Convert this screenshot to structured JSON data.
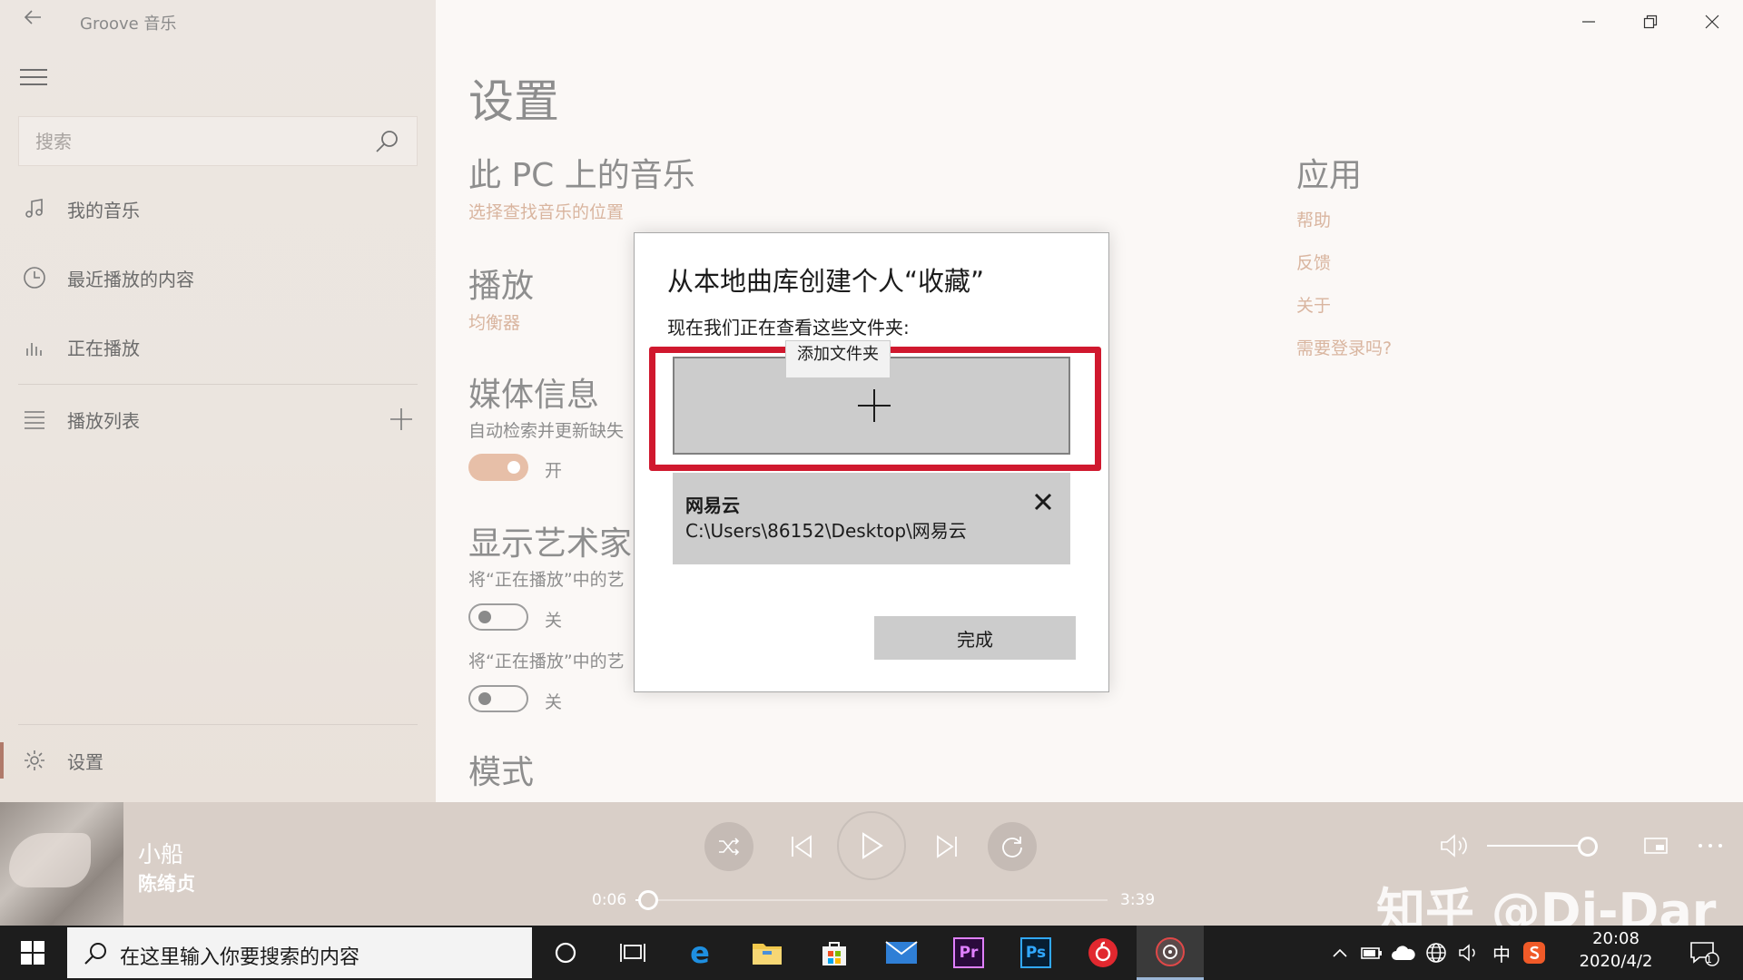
{
  "window": {
    "title": "Groove 音乐"
  },
  "sidebar": {
    "search_placeholder": "搜索",
    "items": [
      {
        "label": "我的音乐"
      },
      {
        "label": "最近播放的内容"
      },
      {
        "label": "正在播放"
      },
      {
        "label": "播放列表"
      }
    ],
    "settings_label": "设置"
  },
  "settings": {
    "page_title": "设置",
    "music_on_pc": {
      "title": "此 PC 上的音乐",
      "link": "选择查找音乐的位置"
    },
    "playback": {
      "title": "播放",
      "link": "均衡器"
    },
    "media_info": {
      "title": "媒体信息",
      "desc": "自动检索并更新缺失",
      "toggle_state": "开"
    },
    "show_artist": {
      "title": "显示艺术家",
      "desc1": "将“正在播放”中的艺",
      "toggle1_state": "关",
      "desc2": "将“正在播放”中的艺",
      "toggle2_state": "关"
    },
    "mode": {
      "title": "模式"
    },
    "app": {
      "title": "应用",
      "links": [
        "帮助",
        "反馈",
        "关于",
        "需要登录吗?"
      ]
    }
  },
  "dialog": {
    "title": "从本地曲库创建个人“收藏”",
    "subtitle": "现在我们正在查看这些文件夹:",
    "tooltip": "添加文件夹",
    "folder": {
      "name": "网易云",
      "path": "C:\\Users\\86152\\Desktop\\网易云"
    },
    "done_label": "完成"
  },
  "player": {
    "track_title": "小船",
    "artist": "陈绮贞",
    "elapsed": "0:06",
    "duration": "3:39",
    "progress_fraction": 0.027,
    "volume_fraction": 0.9
  },
  "watermark": "知乎 @Di-Dar",
  "taskbar": {
    "search_placeholder": "在这里输入你要搜索的内容",
    "pinned": [
      "cortana-icon",
      "task-view-icon",
      "edge-icon",
      "file-explorer-icon",
      "store-icon",
      "mail-icon",
      "premiere-icon",
      "photoshop-icon",
      "netease-music-icon",
      "groove-music-icon"
    ],
    "ime": "中",
    "time": "20:08",
    "date": "2020/4/2",
    "notification_count": "1"
  },
  "colors": {
    "accent_link": "#d9b59f",
    "highlight_red": "#d0182e",
    "toggle_on": "#e7bfa8"
  }
}
